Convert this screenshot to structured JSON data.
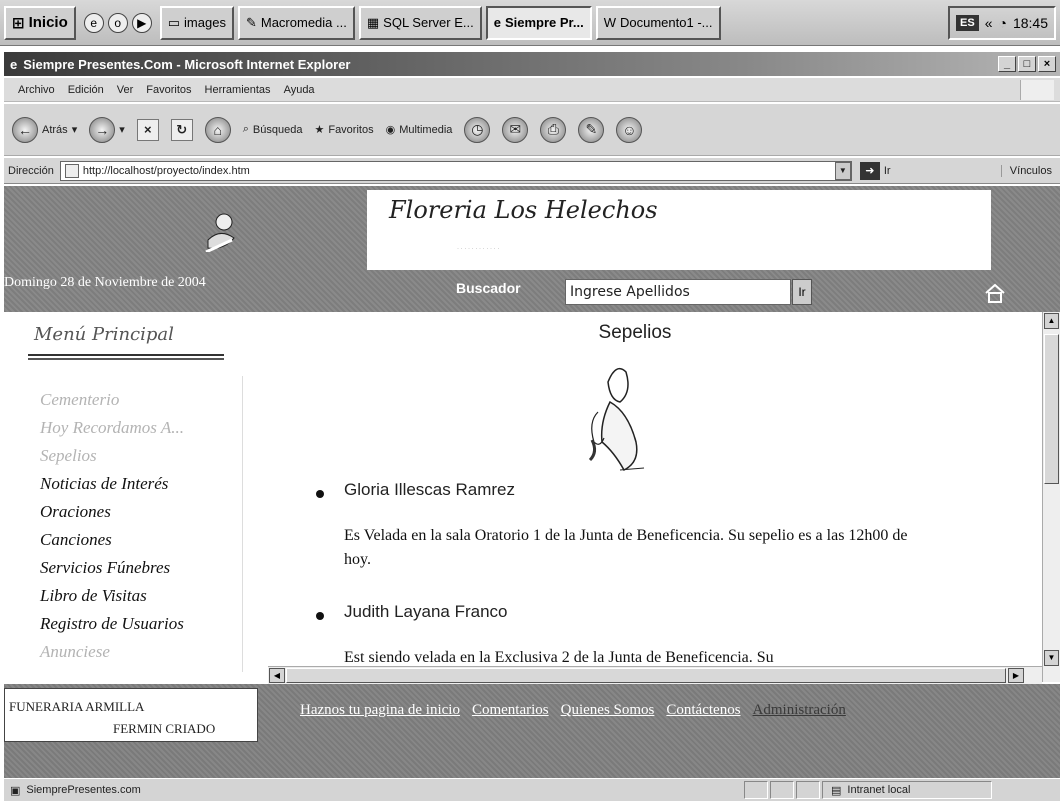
{
  "taskbar": {
    "start_label": "Inicio",
    "buttons": [
      "images",
      "Macromedia ...",
      "SQL Server E...",
      "Siempre Pr...",
      "Documento1 -..."
    ],
    "active_index": 3,
    "language": "ES",
    "clock": "18:45"
  },
  "window": {
    "title": "Siempre Presentes.Com - Microsoft Internet Explorer"
  },
  "menubar": {
    "items": [
      "Archivo",
      "Edición",
      "Ver",
      "Favoritos",
      "Herramientas",
      "Ayuda"
    ]
  },
  "toolbar": {
    "back_label": "Atrás",
    "search_label": "Búsqueda",
    "favorites_label": "Favoritos",
    "multimedia_label": "Multimedia"
  },
  "address": {
    "label": "Dirección",
    "url": "http://localhost/proyecto/index.htm",
    "go_label": "Ir",
    "links_label": "Vínculos"
  },
  "site": {
    "logo_title": "Floreria Los Helechos",
    "date": "Domingo 28 de Noviembre de 2004",
    "search_label": "Buscador",
    "search_value": "Ingrese Apellidos",
    "search_button": "Ir"
  },
  "sidebar": {
    "title": "Menú Principal",
    "items": [
      {
        "label": "Cementerio",
        "faded": true
      },
      {
        "label": "Hoy Recordamos A...",
        "faded": true
      },
      {
        "label": "Sepelios",
        "faded": true
      },
      {
        "label": "Noticias de Interés",
        "faded": false
      },
      {
        "label": "Oraciones",
        "faded": false
      },
      {
        "label": "Canciones",
        "faded": false
      },
      {
        "label": "Servicios Fúnebres",
        "faded": false
      },
      {
        "label": "Libro de Visitas",
        "faded": false
      },
      {
        "label": "Registro de Usuarios",
        "faded": false
      },
      {
        "label": "Anunciese",
        "faded": true
      }
    ]
  },
  "main": {
    "title": "Sepelios",
    "entries": [
      {
        "name": "Gloria Illescas Ramrez",
        "text": "Es Velada en la sala Oratorio 1 de la Junta de Beneficencia. Su sepelio es a las 12h00 de hoy."
      },
      {
        "name": "Judith Layana Franco",
        "text": "Est siendo velada en la Exclusiva 2 de la Junta de Beneficencia. Su"
      }
    ]
  },
  "footer": {
    "brand_line1": "FUNERARIA ARMILLA",
    "brand_line2": "FERMIN CRIADO",
    "links": [
      "Haznos tu pagina de inicio",
      "Comentarios",
      "Quienes Somos",
      "Contáctenos",
      "Administración"
    ]
  },
  "status": {
    "text": "SiemprePresentes.com",
    "zone": "Intranet local"
  }
}
